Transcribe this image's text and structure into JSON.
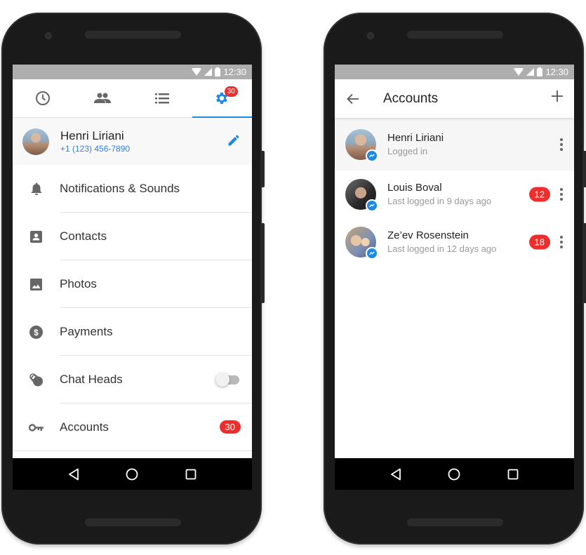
{
  "status_bar": {
    "time": "12:30"
  },
  "left_phone": {
    "tabs": [
      {
        "icon": "clock-icon",
        "label": "Recent",
        "active": false
      },
      {
        "icon": "people-icon",
        "label": "People",
        "active": false
      },
      {
        "icon": "list-icon",
        "label": "Groups",
        "active": false
      },
      {
        "icon": "gear-icon",
        "label": "Settings",
        "active": true,
        "badge": "30"
      }
    ],
    "profile": {
      "name": "Henri Liriani",
      "phone": "+1 (123) 456-7890"
    },
    "settings": [
      {
        "icon": "bell-icon",
        "label": "Notifications & Sounds"
      },
      {
        "icon": "contact-card-icon",
        "label": "Contacts"
      },
      {
        "icon": "photo-icon",
        "label": "Photos"
      },
      {
        "icon": "dollar-icon",
        "label": "Payments"
      },
      {
        "icon": "chat-heads-icon",
        "label": "Chat Heads",
        "toggle": false
      },
      {
        "icon": "key-icon",
        "label": "Accounts",
        "badge": "30"
      }
    ],
    "colors": {
      "accent": "#1e88e5",
      "badge": "#f02d2d"
    }
  },
  "right_phone": {
    "title": "Accounts",
    "accounts": [
      {
        "name": "Henri Liriani",
        "status": "Logged in",
        "badge": null,
        "current": true
      },
      {
        "name": "Louis Boval",
        "status": "Last logged in 9 days ago",
        "badge": "12",
        "current": false
      },
      {
        "name": "Ze’ev Rosenstein",
        "status": "Last logged in 12 days ago",
        "badge": "18",
        "current": false
      }
    ]
  }
}
